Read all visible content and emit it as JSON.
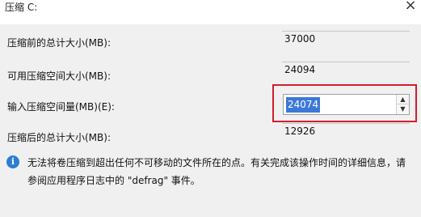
{
  "window": {
    "title": "压缩 C:",
    "close_label": "×"
  },
  "rows": {
    "total_before": {
      "label": "压缩前的总计大小(MB):",
      "value": "37000"
    },
    "available_space": {
      "label": "可用压缩空间大小(MB):",
      "value": "24094"
    },
    "shrink_amount": {
      "label": "输入压缩空间量(MB)(E):",
      "value": "24074"
    },
    "total_after": {
      "label": "压缩后的总计大小(MB):",
      "value": "12926"
    }
  },
  "info": {
    "line1": "无法将卷压缩到超出任何不可移动的文件所在的点。有关完成该操作时间的详细信息，请",
    "line2": "参阅应用程序日志中的 \"defrag\" 事件。"
  },
  "spin": {
    "up": "▲",
    "down": "▼"
  },
  "colors": {
    "highlight_border": "#d11f2d",
    "selection": "#3c78d8",
    "info_icon": "#2d7dd2"
  }
}
